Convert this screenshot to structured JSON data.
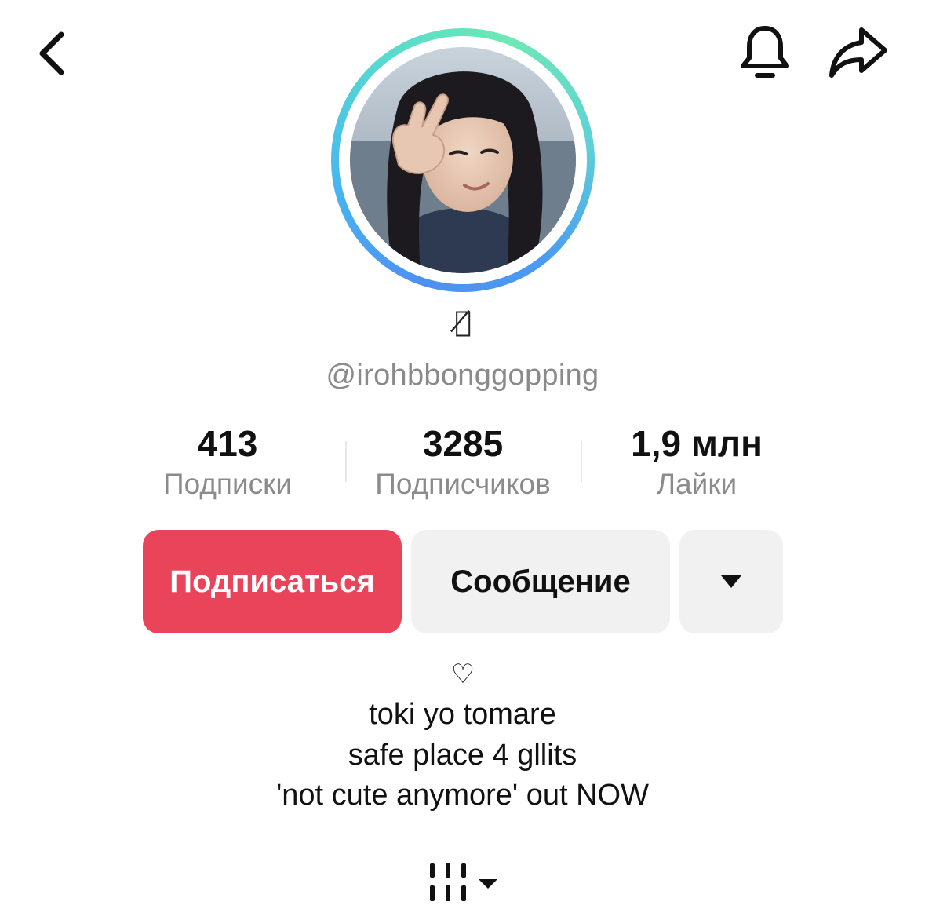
{
  "header": {
    "back_icon": "chevron-left-icon",
    "bell_icon": "bell-icon",
    "share_icon": "share-arrow-icon"
  },
  "profile": {
    "avatar_ring_colors": [
      "#4f8ff2",
      "#56d9d0",
      "#6ee8b3"
    ],
    "nickname": "ᯓ̸",
    "username": "@irohbbonggopping"
  },
  "stats": [
    {
      "value": "413",
      "label": "Подписки"
    },
    {
      "value": "3285",
      "label": "Подписчиков"
    },
    {
      "value": "1,9 млн",
      "label": "Лайки"
    }
  ],
  "actions": {
    "follow_label": "Подписаться",
    "follow_color": "#ea445b",
    "message_label": "Сообщение",
    "more_icon": "caret-down-icon"
  },
  "bio": {
    "heart": "♡",
    "lines": [
      "toki yo tomare",
      "safe place 4 gllits",
      "'not cute anymore' out NOW"
    ]
  },
  "tabs": {
    "grid_icon": "videos-grid-icon"
  }
}
